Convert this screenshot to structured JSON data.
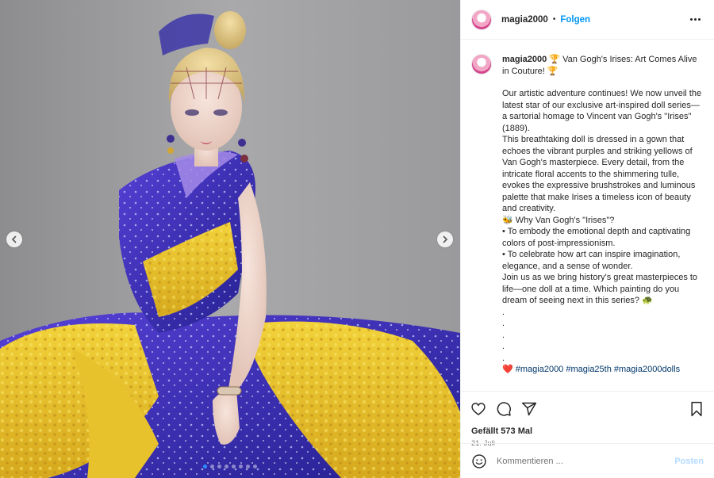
{
  "header": {
    "username": "magia2000",
    "separator": "•",
    "follow_label": "Folgen"
  },
  "caption": {
    "username": "magia2000",
    "title": "🏆 Van Gogh's Irises: Art Comes Alive in Couture! 🏆",
    "paragraphs": [
      "Our artistic adventure continues! We now unveil the latest star of our exclusive art-inspired doll series—a sartorial homage to Vincent van Gogh's \"Irises\" (1889).",
      "This breathtaking doll is dressed in a gown that echoes the vibrant purples and striking yellows of Van Gogh's masterpiece. Every detail, from the intricate floral accents to the shimmering tulle, evokes the expressive brushstrokes and luminous palette that make Irises a timeless icon of beauty and creativity.",
      "🐝 Why Van Gogh's \"Irises\"?",
      "• To embody the emotional depth and captivating colors of post-impressionism.",
      "• To celebrate how art can inspire imagination, elegance, and a sense of wonder.",
      "Join us as we bring history's great masterpieces to life—one doll at a time. Which painting do you dream of seeing next in this series? 🐢"
    ],
    "dots": [
      ".",
      ".",
      ".",
      ".",
      "."
    ],
    "hashtags": "❤️ #magia2000 #magia25th #magia2000dolls"
  },
  "likes": "Gefällt 573 Mal",
  "date": "21. Juli",
  "comment_input": {
    "placeholder": "Kommentieren ...",
    "post_label": "Posten"
  },
  "carousel": {
    "total": 8,
    "active_index": 0
  },
  "colors": {
    "accent": "#0095f6",
    "link": "#00376b",
    "post_disabled": "#b3dbff",
    "gown_purple": "#3b2fb5",
    "gown_yellow": "#e9c62a"
  },
  "icons": {
    "prev": "chevron-left-icon",
    "next": "chevron-right-icon",
    "like": "heart-icon",
    "comment": "comment-icon",
    "share": "send-icon",
    "save": "bookmark-icon",
    "emoji": "smiley-icon",
    "more": "more-icon"
  }
}
